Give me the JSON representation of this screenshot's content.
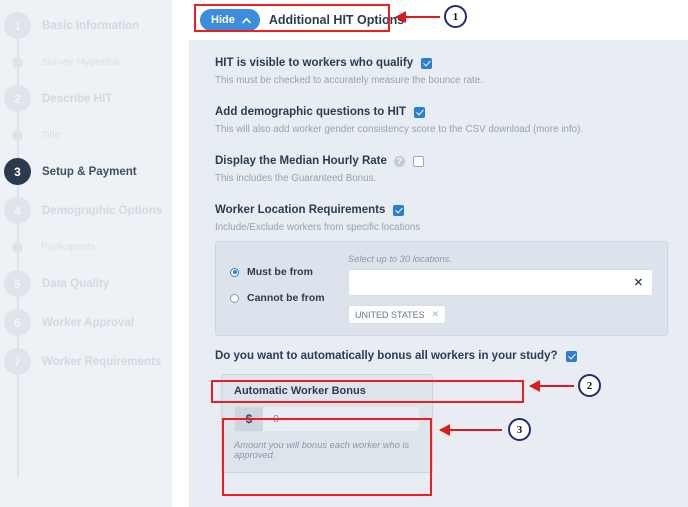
{
  "sidebar": {
    "items": [
      {
        "type": "step",
        "number": "1",
        "label": "Basic Information",
        "active": false
      },
      {
        "type": "substep",
        "label": "Survey Hyperlink"
      },
      {
        "type": "step",
        "number": "2",
        "label": "Describe HIT",
        "active": false
      },
      {
        "type": "substep",
        "label": "Title"
      },
      {
        "type": "step",
        "number": "3",
        "label": "Setup & Payment",
        "active": true
      },
      {
        "type": "step",
        "number": "4",
        "label": "Demographic Options",
        "active": false
      },
      {
        "type": "substep",
        "label": "Participants"
      },
      {
        "type": "step",
        "number": "5",
        "label": "Data Quality",
        "active": false
      },
      {
        "type": "step",
        "number": "6",
        "label": "Worker Approval",
        "active": false
      },
      {
        "type": "step",
        "number": "7",
        "label": "Worker Requirements",
        "active": false
      }
    ]
  },
  "panel": {
    "hide_button_label": "Hide",
    "hide_chevron_icon": "chevron-up-icon",
    "title": "Additional HIT Options"
  },
  "options": [
    {
      "title": "HIT is visible to workers who qualify",
      "description": "This must be checked to accurately measure the bounce rate.",
      "checked": true,
      "has_help": false
    },
    {
      "title": "Add demographic questions to HIT",
      "description": "This will also add worker gender consistency score to the CSV download (more info).",
      "checked": true,
      "has_help": false
    },
    {
      "title": "Display the Median Hourly Rate",
      "description": "This includes the Guaranteed Bonus.",
      "checked": false,
      "has_help": true,
      "help_icon": "question-mark-icon"
    },
    {
      "title": "Worker Location Requirements",
      "description": "Include/Exclude workers from specific locations",
      "checked": true,
      "has_help": false
    }
  ],
  "location": {
    "radio_must": "Must be from",
    "radio_cannot": "Cannot be from",
    "selected": "Must be from",
    "hint": "Select up to 30 locations.",
    "input_value": "",
    "clear_icon": "x-icon",
    "tags": [
      {
        "label": "UNITED STATES",
        "remove_icon": "x-icon"
      }
    ]
  },
  "bonus_question": {
    "title": "Do you want to automatically bonus all workers in your study?",
    "checked": true
  },
  "bonus_card": {
    "title": "Automatic Worker Bonus",
    "currency_prefix": "$",
    "value": "0",
    "note": "Amount you will bonus each worker who is approved."
  },
  "annotations": [
    {
      "number": "1"
    },
    {
      "number": "2"
    },
    {
      "number": "3"
    }
  ],
  "colors": {
    "accent_blue": "#3d8ddb",
    "checkbox_blue": "#2a7fd4",
    "annotation_red": "#ef1d1d",
    "annotation_circle": "#252b75",
    "active_step": "#2b3a4f",
    "panel_bg": "#e8edf3",
    "sidebar_bg": "#eef1f5"
  }
}
